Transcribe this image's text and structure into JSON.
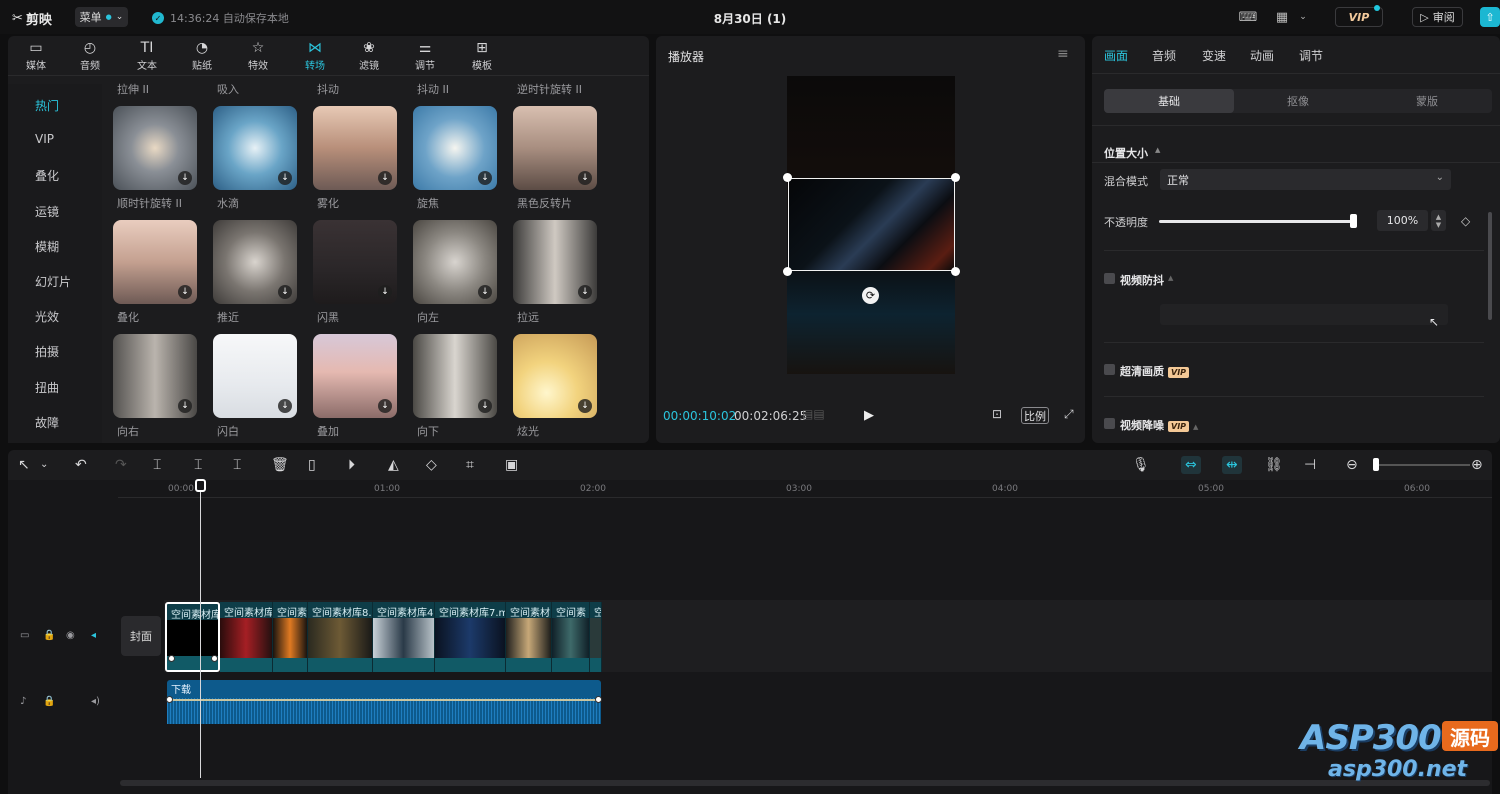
{
  "app": {
    "name": "剪映",
    "menu_label": "菜单",
    "save_status": "14:36:24 自动保存本地",
    "project_title": "8月30日 (1)",
    "vip_label": "VIP",
    "review_label": "审阅"
  },
  "media_tabs": [
    "媒体",
    "音频",
    "文本",
    "贴纸",
    "特效",
    "转场",
    "滤镜",
    "调节",
    "模板"
  ],
  "media_tab_icons": [
    "video-icon",
    "music-icon",
    "text-icon",
    "sticker-icon",
    "effects-icon",
    "transition-icon",
    "filter-icon",
    "adjust-icon",
    "template-icon"
  ],
  "active_media_tab": "转场",
  "categories": [
    "热门",
    "VIP",
    "叠化",
    "运镜",
    "模糊",
    "幻灯片",
    "光效",
    "拍摄",
    "扭曲",
    "故障"
  ],
  "top_labels": [
    "拉伸 II",
    "吸入",
    "抖动",
    "抖动 II",
    "逆时针旋转 II"
  ],
  "transitions": [
    [
      "顺时针旋转 II",
      "水滴",
      "雾化",
      "旋焦",
      "黑色反转片"
    ],
    [
      "叠化",
      "推近",
      "闪黑",
      "向左",
      "拉远"
    ],
    [
      "向右",
      "闪白",
      "叠加",
      "向下",
      "炫光"
    ]
  ],
  "player": {
    "title": "播放器",
    "current_time": "00:00:10:02",
    "total_time": "00:02:06:25",
    "ratio_label": "比例"
  },
  "props": {
    "tabs": [
      "画面",
      "音频",
      "变速",
      "动画",
      "调节"
    ],
    "subtabs": [
      "基础",
      "抠像",
      "蒙版"
    ],
    "position_size": "位置大小",
    "blend_mode_label": "混合模式",
    "blend_mode_value": "正常",
    "opacity_label": "不透明度",
    "opacity_value": "100%",
    "opacity_level": 1.0,
    "stabilize_label": "视频防抖",
    "hq_label": "超清画质",
    "denoise_label": "视频降噪",
    "vip_badge": "VIP"
  },
  "timeline": {
    "ticks": [
      "00:00",
      "01:00",
      "02:00",
      "03:00",
      "04:00",
      "05:00",
      "06:00"
    ],
    "cover_label": "封面",
    "clips": [
      "空间素材库",
      "空间素材库",
      "空间素",
      "空间素材库8.r",
      "空间素材库4",
      "空间素材库7.m",
      "空间素材",
      "空间素",
      "空"
    ],
    "audio_label": "下载"
  },
  "watermark": {
    "brand": "ASP300",
    "tag": "源码",
    "url": "asp300.net"
  }
}
